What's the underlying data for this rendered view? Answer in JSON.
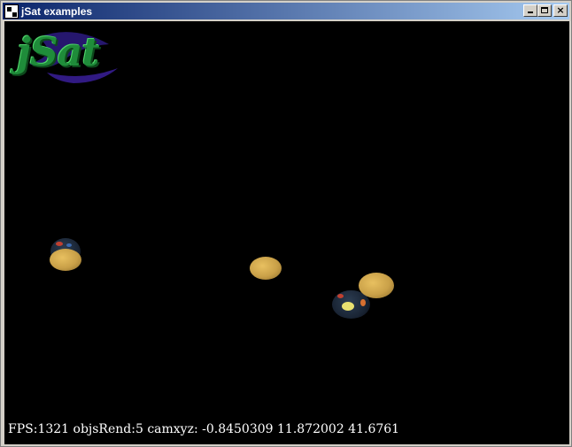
{
  "window": {
    "title": "jSat examples",
    "buttons": {
      "minimize": "minimize",
      "maximize": "maximize",
      "close": "×"
    }
  },
  "viewport": {
    "logo_text": "jSat",
    "hud": "FPS:1321 objsRend:5 camxyz: -0.8450309 11.872002 41.6761",
    "objects": [
      {
        "name": "earth"
      },
      {
        "name": "satellite"
      },
      {
        "name": "satellite"
      },
      {
        "name": "earth"
      },
      {
        "name": "satellite"
      }
    ]
  },
  "colors": {
    "titlebar_start": "#0a246a",
    "titlebar_end": "#a6caf0",
    "background": "#000000",
    "hud_text": "#ffffff",
    "logo": "#1f8c3a",
    "satellite": "#d4a850"
  }
}
